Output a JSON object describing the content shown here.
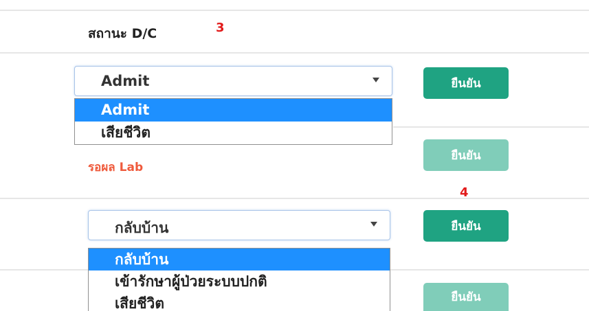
{
  "header": {
    "label": "สถานะ D/C",
    "annotation": "3"
  },
  "row1": {
    "select_value": "Admit",
    "options": [
      "Admit",
      "เสียชีวิต"
    ],
    "confirm_label": "ยืนยัน"
  },
  "row2": {
    "status_text": "รอผล Lab",
    "confirm_label": "ยืนยัน",
    "annotation": "4"
  },
  "row3": {
    "select_value": "กลับบ้าน",
    "options": [
      "กลับบ้าน",
      "เข้ารักษาผู้ป่วยระบบปกติ",
      "เสียชีวิต"
    ],
    "confirm_label": "ยืนยัน"
  },
  "row4": {
    "confirm_label": "ยืนยัน"
  },
  "colors": {
    "button_active": "#1fa382",
    "button_disabled": "#80cdb9",
    "option_highlight": "#1e90ff",
    "status_text": "#ef5a3c",
    "annotation": "#e21b1b"
  }
}
